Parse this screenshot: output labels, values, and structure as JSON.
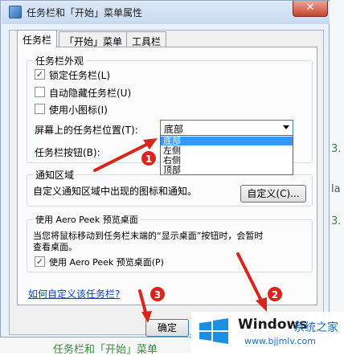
{
  "dialog": {
    "title": "任务栏和「开始」菜单属性",
    "close_glyph": "✕",
    "tabs": [
      {
        "label": "任务栏",
        "active": true
      },
      {
        "label": "「开始」菜单",
        "active": false
      },
      {
        "label": "工具栏",
        "active": false
      }
    ]
  },
  "appearance": {
    "group_label": "任务栏外观",
    "lock": {
      "label": "锁定任务栏(L)",
      "checked": true
    },
    "autohide": {
      "label": "自动隐藏任务栏(U)",
      "checked": false
    },
    "small_icons": {
      "label": "使用小图标(I)",
      "checked": false
    },
    "location_label": "屏幕上的任务栏位置(T):",
    "location_value": "底部",
    "location_options": [
      "底部",
      "左侧",
      "右侧",
      "顶部"
    ],
    "buttons_label": "任务栏按钮(B):"
  },
  "notify": {
    "group_label": "通知区域",
    "desc": "自定义通知区域中出现的图标和通知。",
    "customize_button": "自定义(C)..."
  },
  "peek": {
    "group_label": "使用 Aero Peek 预览桌面",
    "desc_line1": "当您将鼠标移动到任务栏末端的“显示桌面”按钮时，会暂时",
    "desc_line2": "查看桌面。",
    "checkbox": {
      "label": "使用 Aero Peek 预览桌面(P)",
      "checked": true
    }
  },
  "help_link": "如何自定义该任务栏?",
  "ok_button": "确定",
  "annotations": {
    "badge1": "1",
    "badge2": "2",
    "badge3": "3",
    "color": "#d9261c"
  },
  "background": {
    "right_char_a": "3.",
    "right_char_b": "3.",
    "right_char_c": "la",
    "bottom_text": "任务栏和「开始」菜单"
  },
  "watermark": {
    "brand": "Windows",
    "suffix": "系统之家",
    "url": "www.bjjmlv.com"
  }
}
